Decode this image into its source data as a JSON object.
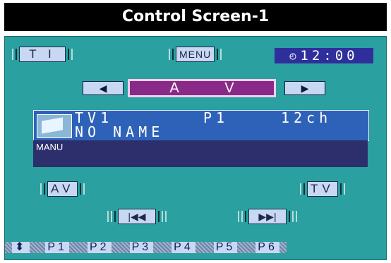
{
  "title": "Control Screen-1",
  "top_bar": {
    "ti_label": "T I",
    "menu_label": "MENU",
    "clock": "12:00"
  },
  "source": {
    "label": "A V"
  },
  "info": {
    "line1_source": "TV1",
    "line1_preset": "P1",
    "line1_channel": "12ch",
    "line2_name": "NO NAME",
    "mode": "MANU"
  },
  "controls": {
    "av_label": "AV",
    "tv_label": "TV"
  },
  "presets": [
    "P1",
    "P2",
    "P3",
    "P4",
    "P5",
    "P6"
  ],
  "colors": {
    "panel_bg": "#2aa0a0",
    "source_bg": "#8a2a88",
    "info_bg": "#2e62b8",
    "clock_bg": "#2f2f9c"
  }
}
